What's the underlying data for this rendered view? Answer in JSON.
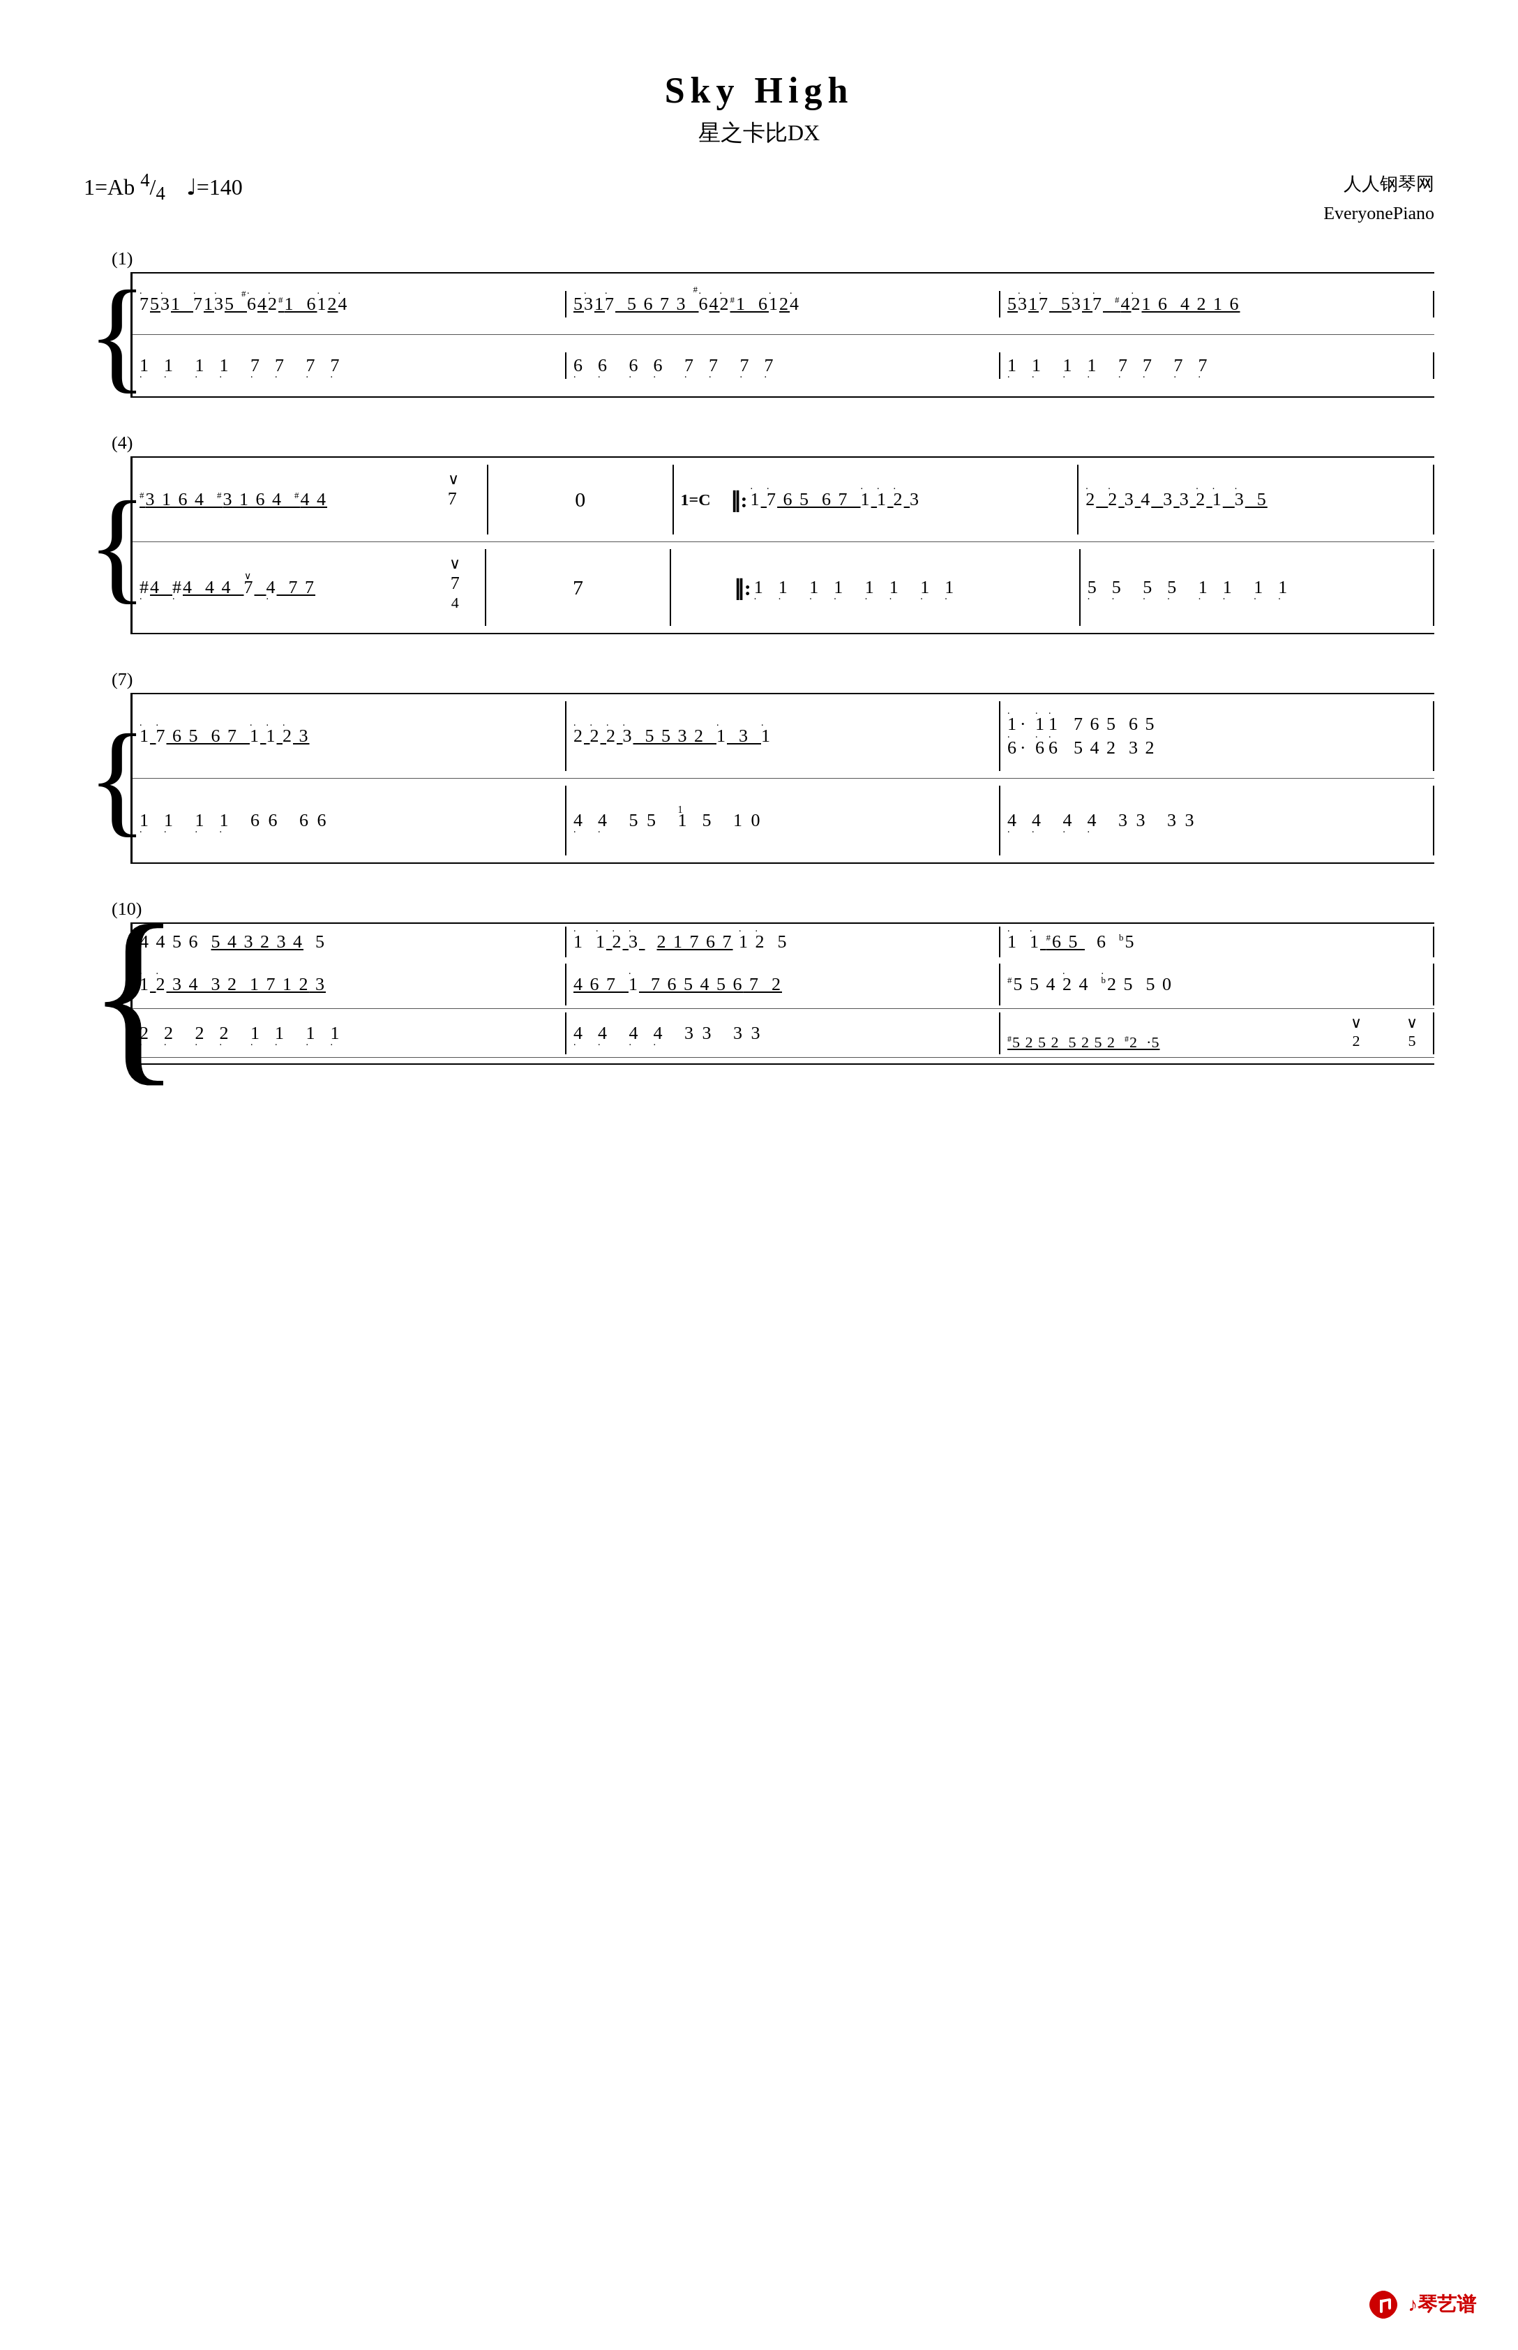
{
  "title": {
    "main": "Sky High",
    "subtitle": "星之卡比DX"
  },
  "meta": {
    "key": "1=Ab",
    "time_sig": "4/4",
    "tempo": "♩=140",
    "source1": "人人钢琴网",
    "source2": "EveryonePiano"
  },
  "logo": {
    "text": "♪琴艺谱"
  },
  "sections": [
    {
      "label": "(1)",
      "measures": []
    },
    {
      "label": "(4)",
      "measures": []
    },
    {
      "label": "(7)",
      "measures": []
    },
    {
      "label": "(10)",
      "measures": []
    }
  ]
}
